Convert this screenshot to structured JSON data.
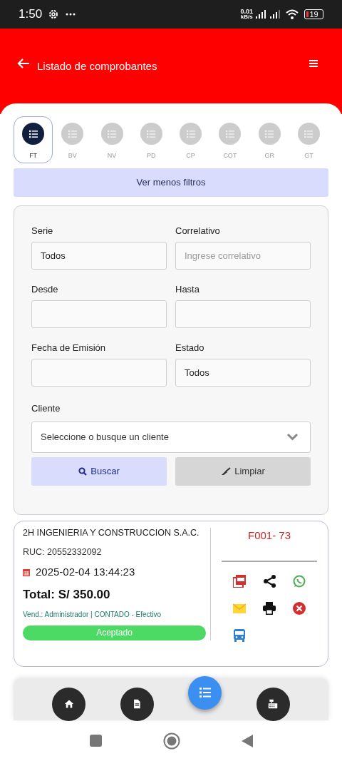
{
  "status_bar": {
    "time": "1:50",
    "net_speed": "0.01",
    "net_unit": "kB/s",
    "battery": "19"
  },
  "header": {
    "title": "Listado de comprobantes"
  },
  "doc_types": [
    {
      "label": "FT",
      "selected": true
    },
    {
      "label": "BV",
      "selected": false
    },
    {
      "label": "NV",
      "selected": false
    },
    {
      "label": "PD",
      "selected": false
    },
    {
      "label": "CP",
      "selected": false
    },
    {
      "label": "COT",
      "selected": false
    },
    {
      "label": "GR",
      "selected": false
    },
    {
      "label": "GT",
      "selected": false
    }
  ],
  "filter_toggle": "Ver menos filtros",
  "filters": [
    {
      "label": "Serie",
      "value": "Todos"
    },
    {
      "label": "Correlativo",
      "placeholder": "Ingrese correlativo"
    },
    {
      "label": "Desde"
    },
    {
      "label": "Hasta"
    },
    {
      "label": "Fecha de Emisión"
    },
    {
      "label": "Estado",
      "value": "Todos"
    }
  ],
  "client_filter": {
    "label": "Cliente",
    "value": "Seleccione o busque un cliente"
  },
  "search_button": "Buscar",
  "clear_button": "Limpiar",
  "receipts": [
    {
      "customer": "2H INGENIERIA Y CONSTRUCCION S.A.C.",
      "ruc": "RUC: 20552332092",
      "date": "2025-02-04 13:44:23",
      "total": "Total: S/ 350.00",
      "seller": "Vend.: Administrador | CONTADO - Efectivo",
      "status": "Aceptado",
      "number": "F001- 73"
    }
  ],
  "bottom_nav": [
    {
      "selected": false
    },
    {
      "selected": false
    },
    {
      "selected": true
    },
    {
      "selected": false
    }
  ]
}
